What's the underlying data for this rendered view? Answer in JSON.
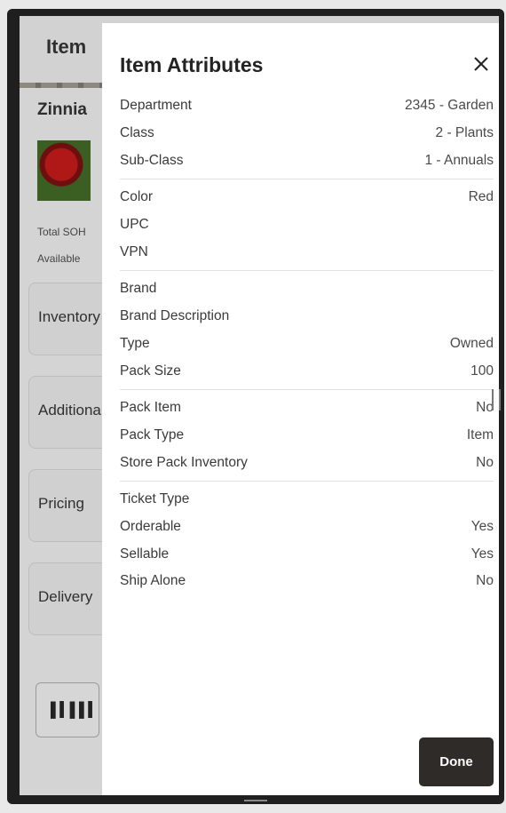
{
  "background": {
    "header_title": "Item",
    "item_title": "Zinnia",
    "total_label": "Total SOH",
    "available_label": "Available",
    "cards": [
      "Inventory",
      "Additional",
      "Pricing",
      "Delivery"
    ]
  },
  "panel": {
    "title": "Item Attributes",
    "done_label": "Done",
    "groups": [
      [
        {
          "label": "Department",
          "value": "2345 - Garden"
        },
        {
          "label": "Class",
          "value": "2 - Plants"
        },
        {
          "label": "Sub-Class",
          "value": "1 - Annuals"
        }
      ],
      [
        {
          "label": "Color",
          "value": "Red"
        },
        {
          "label": "UPC",
          "value": ""
        },
        {
          "label": "VPN",
          "value": ""
        }
      ],
      [
        {
          "label": "Brand",
          "value": ""
        },
        {
          "label": "Brand Description",
          "value": ""
        },
        {
          "label": "Type",
          "value": "Owned"
        },
        {
          "label": "Pack Size",
          "value": "100"
        }
      ],
      [
        {
          "label": "Pack Item",
          "value": "No"
        },
        {
          "label": "Pack Type",
          "value": "Item"
        },
        {
          "label": "Store Pack Inventory",
          "value": "No"
        }
      ],
      [
        {
          "label": "Ticket Type",
          "value": ""
        },
        {
          "label": "Orderable",
          "value": "Yes"
        },
        {
          "label": "Sellable",
          "value": "Yes"
        },
        {
          "label": "Ship Alone",
          "value": "No"
        }
      ]
    ]
  }
}
